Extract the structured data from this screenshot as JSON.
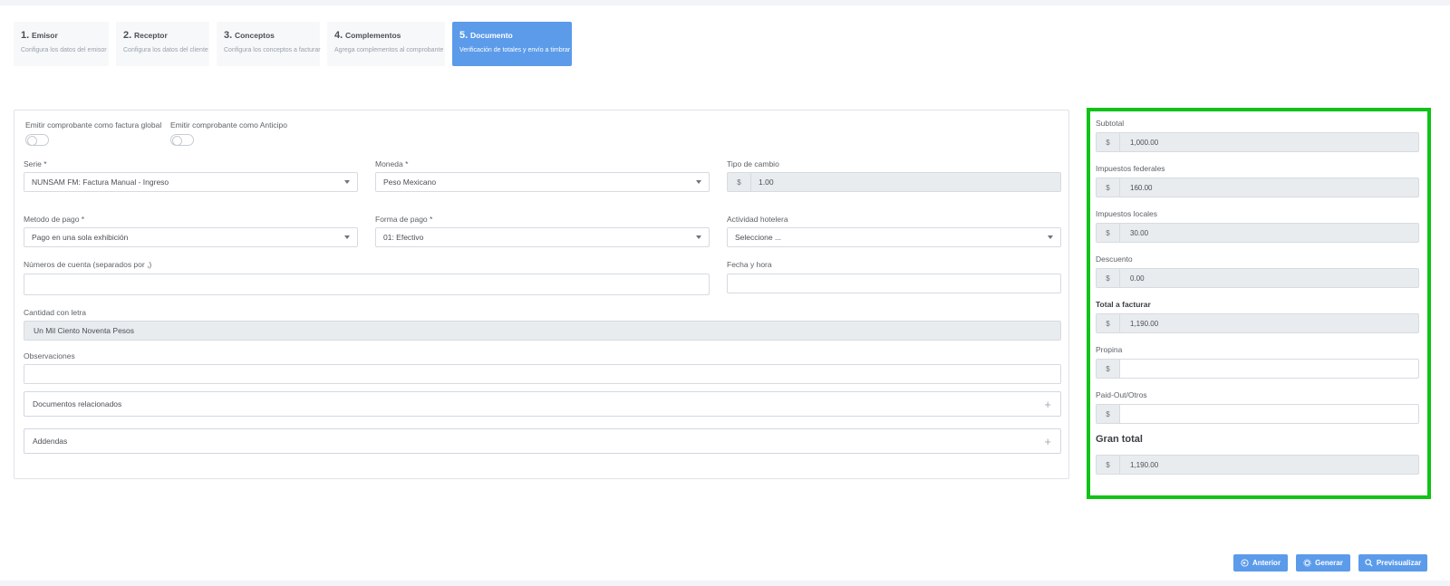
{
  "steps": [
    {
      "num": "1.",
      "label": "Emisor",
      "desc": "Configura los datos del emisor"
    },
    {
      "num": "2.",
      "label": "Receptor",
      "desc": "Configura los datos del cliente"
    },
    {
      "num": "3.",
      "label": "Conceptos",
      "desc": "Configura los conceptos a facturar"
    },
    {
      "num": "4.",
      "label": "Complementos",
      "desc": "Agrega complementos al comprobante"
    },
    {
      "num": "5.",
      "label": "Documento",
      "desc": "Verificación de totales y envío a timbrar"
    }
  ],
  "form": {
    "toggle_global_label": "Emitir comprobante como factura global",
    "toggle_anticipo_label": "Emitir comprobante como Anticipo",
    "serie_label": "Serie *",
    "serie_value": "NUNSAM FM: Factura Manual - Ingreso",
    "moneda_label": "Moneda *",
    "moneda_value": "Peso Mexicano",
    "tipo_cambio_label": "Tipo de cambio",
    "tipo_cambio_value": "1.00",
    "currency_symbol": "$",
    "metodo_pago_label": "Metodo de pago *",
    "metodo_pago_value": "Pago en una sola exhibición",
    "forma_pago_label": "Forma de pago *",
    "forma_pago_value": "01: Efectivo",
    "actividad_label": "Actividad hotelera",
    "actividad_value": "Seleccione ...",
    "cuentas_label": "Números de cuenta (separados por ,)",
    "cuentas_value": "",
    "fecha_label": "Fecha y hora",
    "fecha_value": "",
    "cantidad_label": "Cantidad con letra",
    "cantidad_value": "Un Mil Ciento Noventa Pesos",
    "observaciones_label": "Observaciones",
    "observaciones_value": "",
    "documentos_label": "Documentos relacionados",
    "addendas_label": "Addendas",
    "plus": "+"
  },
  "totals": {
    "currency_symbol": "$",
    "subtotal_label": "Subtotal",
    "subtotal_value": "1,000.00",
    "federales_label": "Impuestos federales",
    "federales_value": "160.00",
    "locales_label": "Impuestos locales",
    "locales_value": "30.00",
    "descuento_label": "Descuento",
    "descuento_value": "0.00",
    "total_label": "Total a facturar",
    "total_value": "1,190.00",
    "propina_label": "Propina",
    "propina_value": "",
    "paidout_label": "Paid-Out/Otros",
    "paidout_value": "",
    "gran_total_label": "Gran total",
    "gran_total_value": "1,190.00"
  },
  "buttons": {
    "anterior": "Anterior",
    "generar": "Generar",
    "previsualizar": "Previsualizar"
  },
  "colors": {
    "accent": "#5b9bea",
    "highlight_border": "#11c217"
  }
}
